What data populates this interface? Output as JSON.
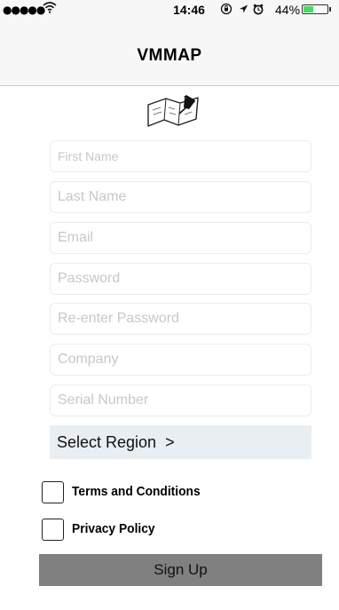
{
  "status_bar": {
    "signal": "●●●●●",
    "wifi_icon": "wifi-icon",
    "time": "14:46",
    "icons": "⊕ ➚ ⏰",
    "battery_percent": "44%",
    "battery_level": 0.44,
    "battery_color": "#4cd964"
  },
  "nav": {
    "title": "VMMAP"
  },
  "logo": {
    "icon": "map-pin-icon"
  },
  "form": {
    "first_name_placeholder": "First Name",
    "last_name_placeholder": "Last Name",
    "email_placeholder": "Email",
    "password_placeholder": "Password",
    "reenter_password_placeholder": "Re-enter Password",
    "company_placeholder": "Company",
    "serial_number_placeholder": "Serial Number",
    "select_region_label": "Select Region  >",
    "terms_label": "Terms and Conditions",
    "privacy_label": "Privacy Policy",
    "signup_label": "Sign Up"
  },
  "colors": {
    "nav_background": "#f7f7f7",
    "select_region_background": "#e9eef3",
    "signup_background": "#808080"
  }
}
